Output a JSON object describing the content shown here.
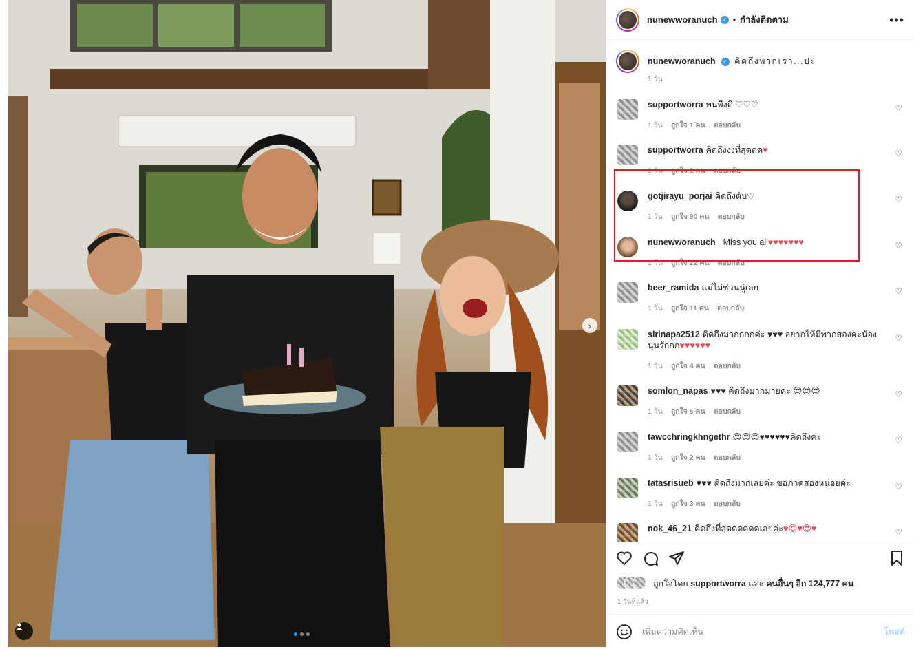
{
  "post": {
    "author": "nunewworanuch",
    "follow_status": "กำลังติดตาม",
    "more": "•••",
    "caption_author": "nunewworanuch",
    "caption": "คิดถึงพวกเรา...ปะ",
    "caption_time": "1 วัน"
  },
  "comments": [
    {
      "user": "supportworra",
      "text": "พนพีงติ",
      "hearts": "♡♡♡",
      "time": "1 วัน",
      "likes": "ถูกใจ 1 คน",
      "reply": "ตอบกลับ"
    },
    {
      "user": "supportworra",
      "text": "คิดถึงงงที่สุดดด",
      "hearts": "♥",
      "time": "1 วัน",
      "likes": "ถูกใจ 1 คน",
      "reply": "ตอบกลับ"
    },
    {
      "user": "gotjirayu_porjai",
      "text": "คิดถึงคับ",
      "hearts": "♡",
      "time": "1 วัน",
      "likes": "ถูกใจ 90 คน",
      "reply": "ตอบกลับ"
    },
    {
      "user": "nunewworanuch_",
      "text": "Miss you all",
      "hearts": "♥♥♥♥♥♥♥",
      "time": "1 วัน",
      "likes": "ถูกใจ 22 คน",
      "reply": "ตอบกลับ"
    },
    {
      "user": "beer_ramida",
      "text": "แม่ไม่ช่วนนู่เลย",
      "hearts": "",
      "time": "1 วัน",
      "likes": "ถูกใจ 11 คน",
      "reply": "ตอบกลับ"
    },
    {
      "user": "sirinapa2512",
      "text": "คิดถึงมากกกกค่ะ ♥♥♥ อยากให้มีพากสองคะน้องนุ่นรักกก",
      "hearts": "♥♥♥♥♥♥",
      "time": "1 วัน",
      "likes": "ถูกใจ 4 คน",
      "reply": "ตอบกลับ"
    },
    {
      "user": "somlon_napas",
      "text": "♥♥♥ คิดถึงมากมายค่ะ",
      "hearts": "😍😍😍",
      "time": "1 วัน",
      "likes": "ถูกใจ 5 คน",
      "reply": "ตอบกลับ"
    },
    {
      "user": "tawcchringkhngethr",
      "text": "😍😍😍♥♥♥♥♥♥",
      "hearts": "คิดถึงค่ะ",
      "time": "1 วัน",
      "likes": "ถูกใจ 2 คน",
      "reply": "ตอบกลับ"
    },
    {
      "user": "tatasrisueb",
      "text": "♥♥♥ คิดถึงมากเลยค่ะ ขอภาคสองหน่อยค่ะ",
      "hearts": "",
      "time": "1 วัน",
      "likes": "ถูกใจ 3 คน",
      "reply": "ตอบกลับ"
    },
    {
      "user": "nok_46_21",
      "text": "คิดถึงที่สุดดดดดดเลยค่ะ",
      "hearts": "♥😍♥😍♥",
      "time": "",
      "likes": "",
      "reply": ""
    }
  ],
  "likes_line": {
    "prefix": "ถูกใจโดย",
    "user": "supportworra",
    "and": "และ",
    "others": "คนอื่นๆ อีก 124,777 คน"
  },
  "time_ago": "1 วันที่แล้ว",
  "add_comment": {
    "placeholder": "เพิ่มความคิดเห็น",
    "post_label": "โพสต์"
  },
  "colors": {
    "accent": "#3897f0",
    "heart": "#ed4956",
    "highlight": "#e01b22"
  }
}
